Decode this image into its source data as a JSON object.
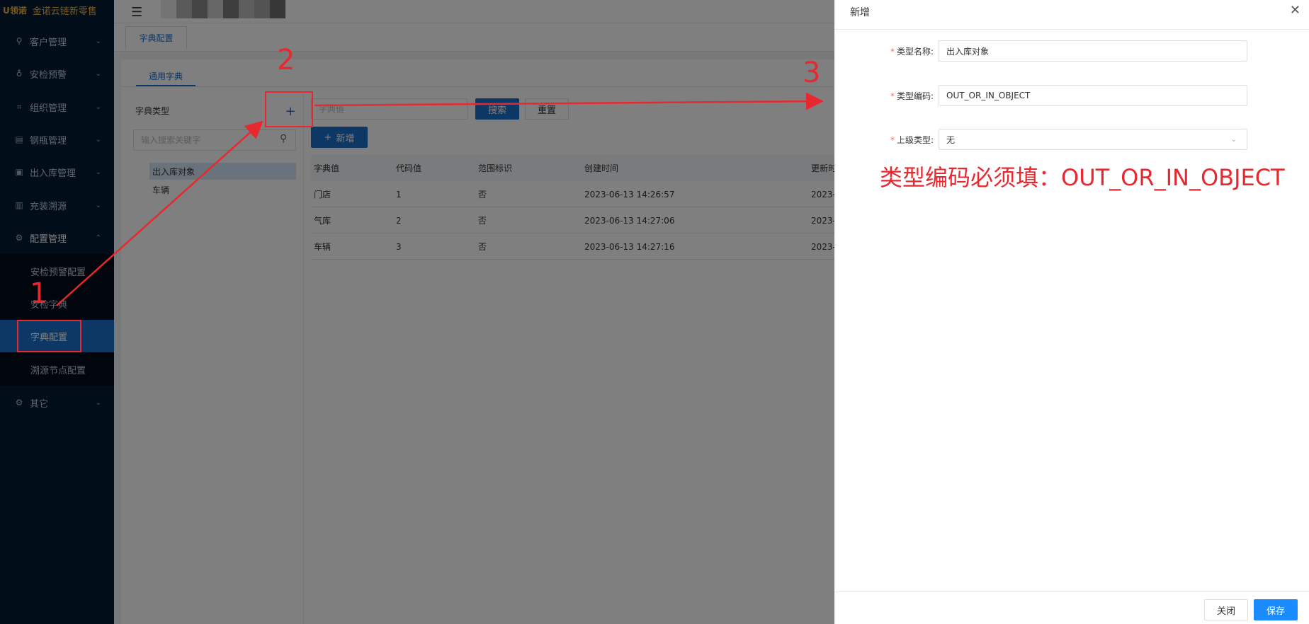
{
  "logo": {
    "mark": "U领诺",
    "name": "金诺云链新零售"
  },
  "sidebar": {
    "items": [
      {
        "label": "客户管理"
      },
      {
        "label": "安检预警"
      },
      {
        "label": "组织管理"
      },
      {
        "label": "钢瓶管理"
      },
      {
        "label": "出入库管理"
      },
      {
        "label": "充装溯源"
      },
      {
        "label": "配置管理"
      },
      {
        "label": "其它"
      }
    ],
    "subitems": [
      {
        "label": "安检预警配置"
      },
      {
        "label": "安检字典"
      },
      {
        "label": "字典配置"
      },
      {
        "label": "溯源节点配置"
      }
    ]
  },
  "tabs": {
    "current": "字典配置"
  },
  "content": {
    "subtab": "通用字典",
    "left": {
      "title": "字典类型",
      "add_icon": "+",
      "search_placeholder": "输入搜索关键字",
      "tree": [
        "出入库对象",
        "车辆"
      ]
    },
    "toolbar": {
      "dict_placeholder": "字典值",
      "search_label": "搜索",
      "reset_label": "重置",
      "add_label": "新增"
    },
    "table": {
      "headers": [
        "字典值",
        "代码值",
        "范围标识",
        "创建时间",
        "更新时"
      ],
      "rows": [
        [
          "门店",
          "1",
          "否",
          "2023-06-13 14:26:57",
          "2023-"
        ],
        [
          "气库",
          "2",
          "否",
          "2023-06-13 14:27:06",
          "2023-"
        ],
        [
          "车辆",
          "3",
          "否",
          "2023-06-13 14:27:16",
          "2023-"
        ]
      ]
    }
  },
  "drawer": {
    "title": "新增",
    "fields": [
      {
        "label": "类型名称:",
        "value": "出入库对象"
      },
      {
        "label": "类型编码:",
        "value": "OUT_OR_IN_OBJECT"
      },
      {
        "label": "上级类型:",
        "value": "无"
      }
    ],
    "annotation": "类型编码必须填：OUT_OR_IN_OBJECT",
    "close_label": "关闭",
    "save_label": "保存"
  },
  "steps": [
    "1",
    "2",
    "3"
  ],
  "colors": {
    "annotation": "#e8282f",
    "primary": "#1a6fc8",
    "sidebar": "#021a33"
  }
}
